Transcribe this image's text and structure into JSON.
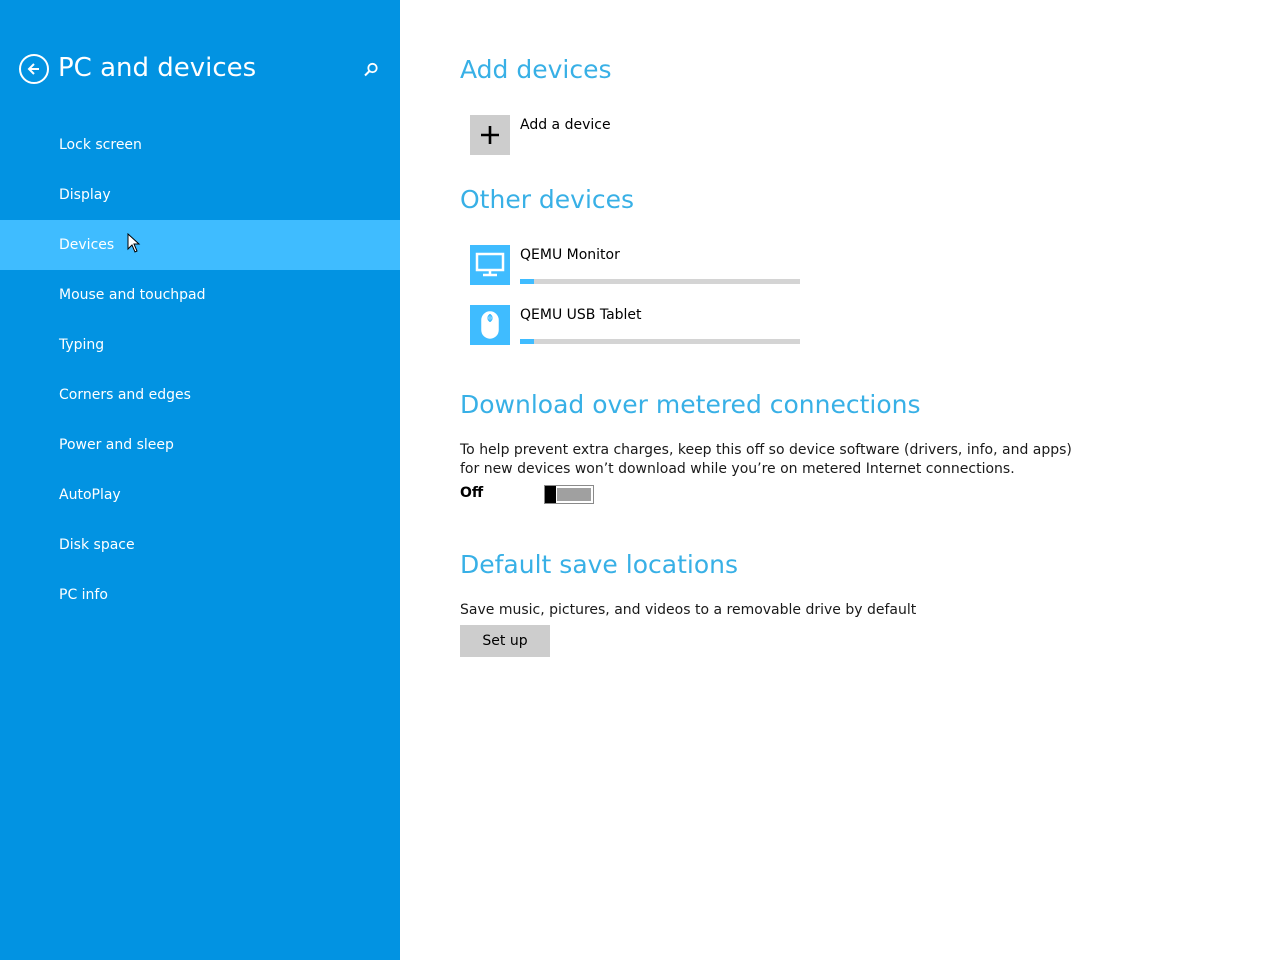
{
  "sidebar": {
    "title": "PC and devices",
    "items": [
      {
        "label": "Lock screen"
      },
      {
        "label": "Display"
      },
      {
        "label": "Devices",
        "active": true
      },
      {
        "label": "Mouse and touchpad"
      },
      {
        "label": "Typing"
      },
      {
        "label": "Corners and edges"
      },
      {
        "label": "Power and sleep"
      },
      {
        "label": "AutoPlay"
      },
      {
        "label": "Disk space"
      },
      {
        "label": "PC info"
      }
    ]
  },
  "add_devices": {
    "title": "Add devices",
    "add_label": "Add a device"
  },
  "other_devices": {
    "title": "Other devices",
    "items": [
      {
        "label": "QEMU Monitor",
        "icon": "monitor-icon",
        "progress": 0.05
      },
      {
        "label": "QEMU USB Tablet",
        "icon": "mouse-icon",
        "progress": 0.05
      }
    ]
  },
  "metered": {
    "title": "Download over metered connections",
    "description": "To help prevent extra charges, keep this off so device software (drivers, info, and apps) for new devices won’t download while you’re on metered Internet connections.",
    "toggle_label": "Off",
    "toggle_on": false
  },
  "save_locations": {
    "title": "Default save locations",
    "description": "Save music, pictures, and videos to a removable drive by default",
    "button_label": "Set up"
  },
  "colors": {
    "sidebar_bg": "#0293e2",
    "sidebar_active": "#3fbcff",
    "heading": "#38b0e6"
  }
}
